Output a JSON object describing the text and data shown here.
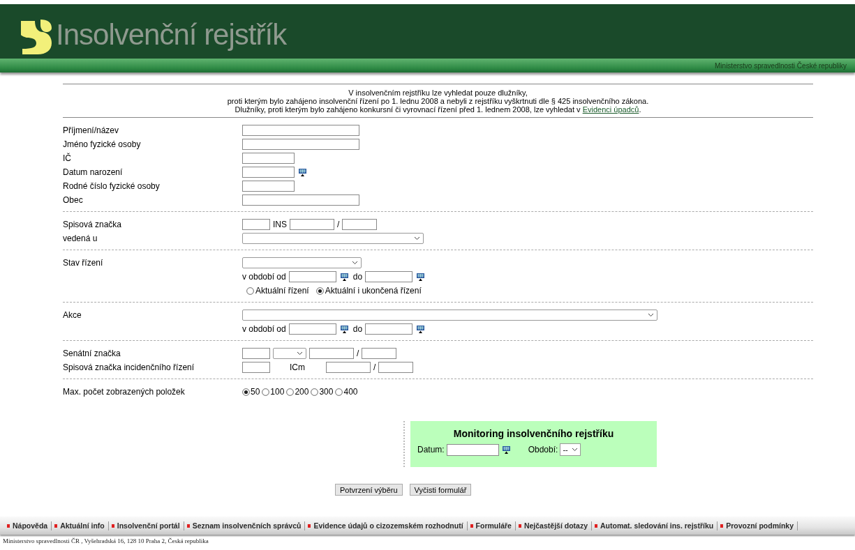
{
  "header": {
    "title": "Insolvenční rejstřík",
    "ministry": "Ministerstvo spravedlnosti České republiky"
  },
  "intro": {
    "lines": [
      "V insolvenčním rejstříku lze vyhledat pouze dlužníky,",
      "proti kterým bylo zahájeno insolvenční řízení po 1. lednu 2008 a nebyli z rejstříku vyškrtnuti dle § 425 insolvenčního zákona."
    ],
    "last_line": "Dlužníky, proti kterým bylo zahájeno konkursní či vyrovnací řízení před 1. lednem 2008, lze vyhledat v ",
    "link": "Evidenci úpadců",
    "end": "."
  },
  "sections": [
    {
      "rows": [
        {
          "label": "Příjmení/název",
          "controls": [
            {
              "kind": "field"
            }
          ]
        },
        {
          "label": "Jméno fyzické osoby",
          "controls": [
            {
              "kind": "field"
            }
          ]
        },
        {
          "label": "IČ",
          "controls": [
            {
              "kind": "field"
            }
          ]
        },
        {
          "label": "Datum narození",
          "controls": [
            {
              "kind": "field"
            },
            {
              "kind": "calendar"
            }
          ]
        },
        {
          "label": "Rodné číslo fyzické osoby",
          "controls": [
            {
              "kind": "field"
            }
          ]
        },
        {
          "label": "Obec",
          "controls": [
            {
              "kind": "field"
            }
          ]
        }
      ]
    },
    {
      "rows": [
        {
          "label": "Spisová značka",
          "controls": [
            {
              "kind": "field"
            },
            {
              "kind": "text",
              "text": "INS"
            },
            {
              "kind": "field"
            },
            {
              "kind": "text",
              "text": "/"
            },
            {
              "kind": "field"
            }
          ]
        },
        {
          "label": "vedená u",
          "controls": [
            {
              "kind": "select"
            }
          ]
        }
      ]
    },
    {
      "rows": [
        {
          "label": "Stav řízení",
          "controls": [
            {
              "kind": "select"
            }
          ]
        },
        {
          "controls": [
            {
              "kind": "text",
              "text": "v období od"
            },
            {
              "kind": "field"
            },
            {
              "kind": "calendar"
            },
            {
              "kind": "text",
              "text": "do"
            },
            {
              "kind": "field"
            },
            {
              "kind": "calendar"
            }
          ]
        },
        {
          "controls": [
            {
              "kind": "radio",
              "label": "Aktuální řízení",
              "selected": false
            },
            {
              "kind": "radio",
              "label": "Aktuální i ukončená řízení",
              "selected": true
            }
          ]
        }
      ]
    },
    {
      "rows": [
        {
          "label": "Akce",
          "controls": [
            {
              "kind": "select"
            }
          ]
        },
        {
          "controls": [
            {
              "kind": "text",
              "text": "v období od"
            },
            {
              "kind": "field"
            },
            {
              "kind": "calendar"
            },
            {
              "kind": "text",
              "text": "do"
            },
            {
              "kind": "field"
            },
            {
              "kind": "calendar"
            }
          ]
        }
      ]
    },
    {
      "rows": [
        {
          "label": "Senátní značka",
          "controls": [
            {
              "kind": "field"
            },
            {
              "kind": "select"
            },
            {
              "kind": "field"
            },
            {
              "kind": "text",
              "text": "/"
            },
            {
              "kind": "field"
            }
          ]
        },
        {
          "label": "Spisová značka incidenčního řízení",
          "controls": [
            {
              "kind": "field"
            },
            {
              "kind": "gaptext",
              "text": "ICm"
            },
            {
              "kind": "field"
            },
            {
              "kind": "text",
              "text": "/"
            },
            {
              "kind": "field"
            }
          ]
        }
      ]
    },
    {
      "rows": [
        {
          "label": "Max. počet zobrazených položek",
          "controls": [
            {
              "kind": "radio",
              "label": "50",
              "selected": true
            },
            {
              "kind": "radio",
              "label": "100",
              "selected": false
            },
            {
              "kind": "radio",
              "label": "200",
              "selected": false
            },
            {
              "kind": "radio",
              "label": "300",
              "selected": false
            },
            {
              "kind": "radio",
              "label": "400",
              "selected": false
            }
          ]
        }
      ]
    }
  ],
  "monitoring": {
    "title": "Monitoring insolvenčního rejstříku",
    "date_label": "Datum:",
    "period_label": "Období:",
    "period_value": "--"
  },
  "buttons": [
    "Potvrzení výběru",
    "Vyčisti formulář"
  ],
  "footer_nav": [
    "Nápověda",
    "Aktuální info",
    "Insolvenční portál",
    "Seznam insolvenčních správců",
    "Evidence údajů o cizozemském rozhodnutí",
    "Formuláře",
    "Nejčastější dotazy",
    "Automat. sledování ins. rejstříku",
    "Provozní podmínky"
  ],
  "address": "Ministerstvo spravedlnosti ČR , Vyšehradská 16, 128 10 Praha 2, Česká republika"
}
